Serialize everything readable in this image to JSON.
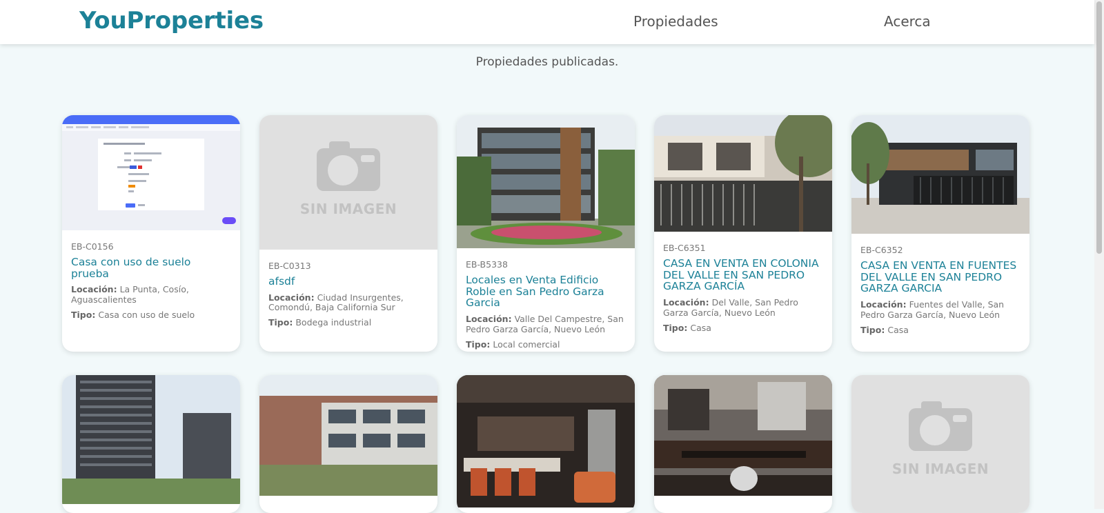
{
  "navbar": {
    "logo": "YouProperties",
    "links": [
      "Propiedades",
      "Acerca"
    ]
  },
  "heading": "Propiedades publicadas.",
  "labels": {
    "location": "Locación:",
    "type": "Tipo:"
  },
  "no_image_text": "SIN IMAGEN",
  "colors": {
    "accent": "#1c8197",
    "background": "#f2f9fa",
    "text_muted": "#777777"
  },
  "properties": [
    {
      "code": "EB-C0156",
      "title": "Casa con uso de suelo prueba",
      "location": "La Punta, Cosío, Aguascalientes",
      "type": "Casa con uso de suelo",
      "image": "screenshot-thumbnail"
    },
    {
      "code": "EB-C0313",
      "title": "afsdf",
      "location": "Ciudad Insurgentes, Comondú, Baja California Sur",
      "type": "Bodega industrial",
      "image": "no-image-placeholder"
    },
    {
      "code": "EB-B5338",
      "title": "Locales en Venta Edificio Roble en San Pedro Garza Garcia",
      "location": "Valle Del Campestre, San Pedro Garza García, Nuevo León",
      "type": "Local comercial",
      "image": "building-photo"
    },
    {
      "code": "EB-C6351",
      "title": "CASA EN VENTA EN COLONIA DEL VALLE EN SAN PEDRO GARZA GARCÍA",
      "location": "Del Valle, San Pedro Garza García, Nuevo León",
      "type": "Casa",
      "image": "house-photo"
    },
    {
      "code": "EB-C6352",
      "title": "CASA EN VENTA EN FUENTES DEL VALLE EN SAN PEDRO GARZA GARCIA",
      "location": "Fuentes del Valle, San Pedro Garza García, Nuevo León",
      "type": "Casa",
      "image": "house-photo"
    },
    {
      "image": "tower-photo"
    },
    {
      "image": "apartments-photo"
    },
    {
      "image": "interior-photo"
    },
    {
      "image": "kitchen-photo"
    },
    {
      "image": "no-image-placeholder"
    }
  ]
}
